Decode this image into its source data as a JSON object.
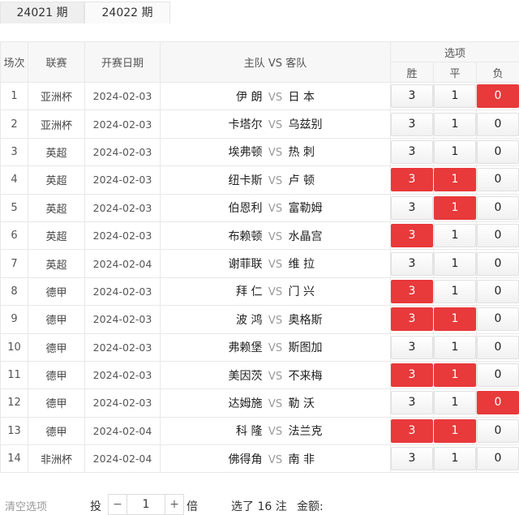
{
  "tabs": [
    "24021 期",
    "24022 期"
  ],
  "header": {
    "col_no": "场次",
    "col_league": "联赛",
    "col_date": "开赛日期",
    "col_match": "主队 VS 客队",
    "col_options": "选项",
    "opt_win": "胜",
    "opt_draw": "平",
    "opt_lose": "负"
  },
  "vs": "VS",
  "matches": [
    {
      "no": "1",
      "league": "亚洲杯",
      "date": "2024-02-03",
      "home": "伊 朗",
      "away": "日 本",
      "win": "3",
      "draw": "1",
      "lose": "0",
      "sel": [
        false,
        false,
        true
      ]
    },
    {
      "no": "2",
      "league": "亚洲杯",
      "date": "2024-02-03",
      "home": "卡塔尔",
      "away": "乌兹别",
      "win": "3",
      "draw": "1",
      "lose": "0",
      "sel": [
        false,
        false,
        false
      ]
    },
    {
      "no": "3",
      "league": "英超",
      "date": "2024-02-03",
      "home": "埃弗顿",
      "away": "热 刺",
      "win": "3",
      "draw": "1",
      "lose": "0",
      "sel": [
        false,
        false,
        false
      ]
    },
    {
      "no": "4",
      "league": "英超",
      "date": "2024-02-03",
      "home": "纽卡斯",
      "away": "卢 顿",
      "win": "3",
      "draw": "1",
      "lose": "0",
      "sel": [
        true,
        true,
        false
      ]
    },
    {
      "no": "5",
      "league": "英超",
      "date": "2024-02-03",
      "home": "伯恩利",
      "away": "富勒姆",
      "win": "3",
      "draw": "1",
      "lose": "0",
      "sel": [
        false,
        true,
        false
      ]
    },
    {
      "no": "6",
      "league": "英超",
      "date": "2024-02-03",
      "home": "布赖顿",
      "away": "水晶宫",
      "win": "3",
      "draw": "1",
      "lose": "0",
      "sel": [
        true,
        false,
        false
      ]
    },
    {
      "no": "7",
      "league": "英超",
      "date": "2024-02-04",
      "home": "谢菲联",
      "away": "维 拉",
      "win": "3",
      "draw": "1",
      "lose": "0",
      "sel": [
        false,
        false,
        false
      ]
    },
    {
      "no": "8",
      "league": "德甲",
      "date": "2024-02-03",
      "home": "拜 仁",
      "away": "门 兴",
      "win": "3",
      "draw": "1",
      "lose": "0",
      "sel": [
        true,
        false,
        false
      ]
    },
    {
      "no": "9",
      "league": "德甲",
      "date": "2024-02-03",
      "home": "波 鸿",
      "away": "奥格斯",
      "win": "3",
      "draw": "1",
      "lose": "0",
      "sel": [
        true,
        true,
        false
      ]
    },
    {
      "no": "10",
      "league": "德甲",
      "date": "2024-02-03",
      "home": "弗赖堡",
      "away": "斯图加",
      "win": "3",
      "draw": "1",
      "lose": "0",
      "sel": [
        false,
        false,
        false
      ]
    },
    {
      "no": "11",
      "league": "德甲",
      "date": "2024-02-03",
      "home": "美因茨",
      "away": "不来梅",
      "win": "3",
      "draw": "1",
      "lose": "0",
      "sel": [
        true,
        true,
        false
      ]
    },
    {
      "no": "12",
      "league": "德甲",
      "date": "2024-02-03",
      "home": "达姆施",
      "away": "勒 沃",
      "win": "3",
      "draw": "1",
      "lose": "0",
      "sel": [
        false,
        false,
        true
      ]
    },
    {
      "no": "13",
      "league": "德甲",
      "date": "2024-02-04",
      "home": "科 隆",
      "away": "法兰克",
      "win": "3",
      "draw": "1",
      "lose": "0",
      "sel": [
        true,
        true,
        false
      ]
    },
    {
      "no": "14",
      "league": "非洲杯",
      "date": "2024-02-04",
      "home": "佛得角",
      "away": "南 非",
      "win": "3",
      "draw": "1",
      "lose": "0",
      "sel": [
        false,
        false,
        false
      ]
    }
  ],
  "footer": {
    "clear": "清空选项",
    "tou": "投",
    "minus": "−",
    "multiplier": "1",
    "plus": "+",
    "bei": "倍",
    "selected": "选了 16 注",
    "amount": "金额:"
  },
  "colors": {
    "selected": "#e8393b"
  }
}
